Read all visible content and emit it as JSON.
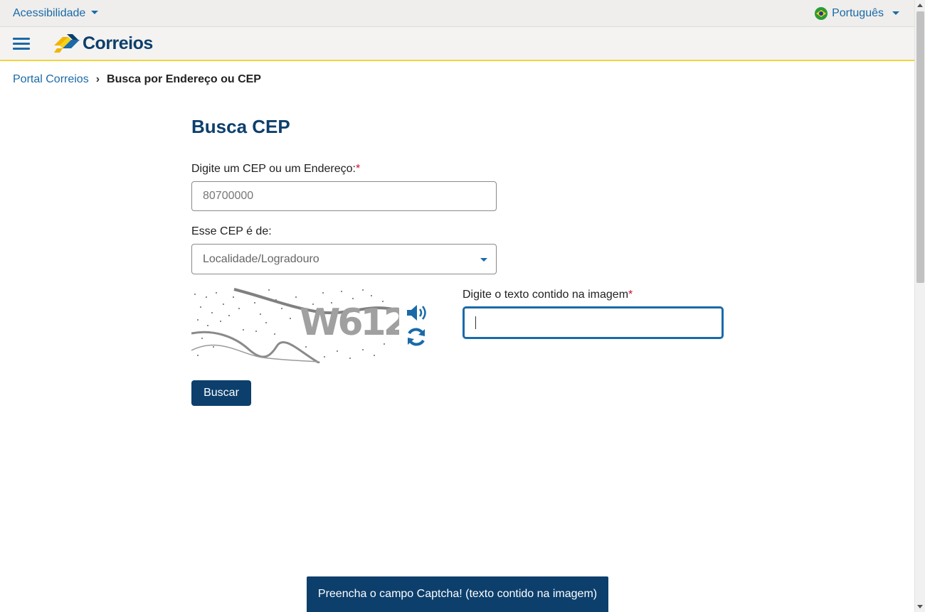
{
  "topbar": {
    "accessibility_label": "Acessibilidade",
    "language_label": "Português"
  },
  "header": {
    "logo_text": "Correios",
    "menu_icon": "hamburger-menu-icon"
  },
  "breadcrumb": {
    "home": "Portal Correios",
    "separator": "›",
    "current": "Busca por Endereço ou CEP"
  },
  "form": {
    "title": "Busca CEP",
    "cep_label": "Digite um CEP ou um Endereço:",
    "required_mark": "*",
    "cep_placeholder": "80700000",
    "type_label": "Esse CEP é de:",
    "type_selected": "Localidade/Logradouro",
    "captcha_label": "Digite o texto contido na imagem",
    "captcha_text": "W612",
    "audio_icon": "speaker-icon",
    "refresh_icon": "refresh-icon",
    "captcha_value": "",
    "submit_label": "Buscar"
  },
  "toast": {
    "message": "Preencha o campo Captcha! (texto contido na imagem)"
  },
  "colors": {
    "brand_blue": "#0c3f6c",
    "link_blue": "#1a6aa8",
    "accent_yellow": "#f2d43b",
    "required_red": "#c8102e"
  }
}
